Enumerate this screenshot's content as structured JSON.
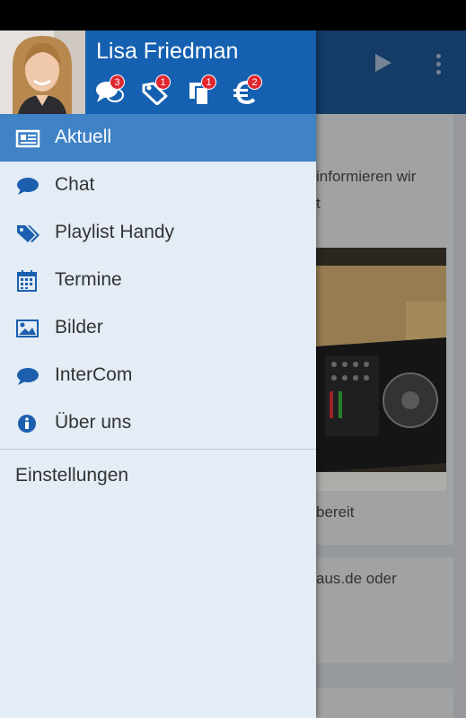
{
  "profile": {
    "name": "Lisa Friedman",
    "badges": {
      "chat": "3",
      "tags": "1",
      "copy": "1",
      "euro": "2"
    }
  },
  "menu": {
    "items": [
      {
        "label": "Aktuell",
        "icon": "newspaper-icon",
        "active": true
      },
      {
        "label": "Chat",
        "icon": "chat-bubble-icon"
      },
      {
        "label": "Playlist Handy",
        "icon": "tags-icon"
      },
      {
        "label": "Termine",
        "icon": "calendar-icon"
      },
      {
        "label": "Bilder",
        "icon": "picture-icon"
      },
      {
        "label": "InterCom",
        "icon": "chat-bubble-icon"
      },
      {
        "label": "Über uns",
        "icon": "info-icon"
      }
    ],
    "settings_label": "Einstellungen"
  },
  "background": {
    "text1": "informieren wir",
    "text1_cont": "t",
    "caption": "bereit",
    "text2": "aus.de oder"
  },
  "colors": {
    "header": "#1560b0",
    "active_item": "#3f82c6",
    "drawer_bg": "#e4ecf5",
    "icon": "#1b5fae",
    "badge": "#e0262f"
  }
}
